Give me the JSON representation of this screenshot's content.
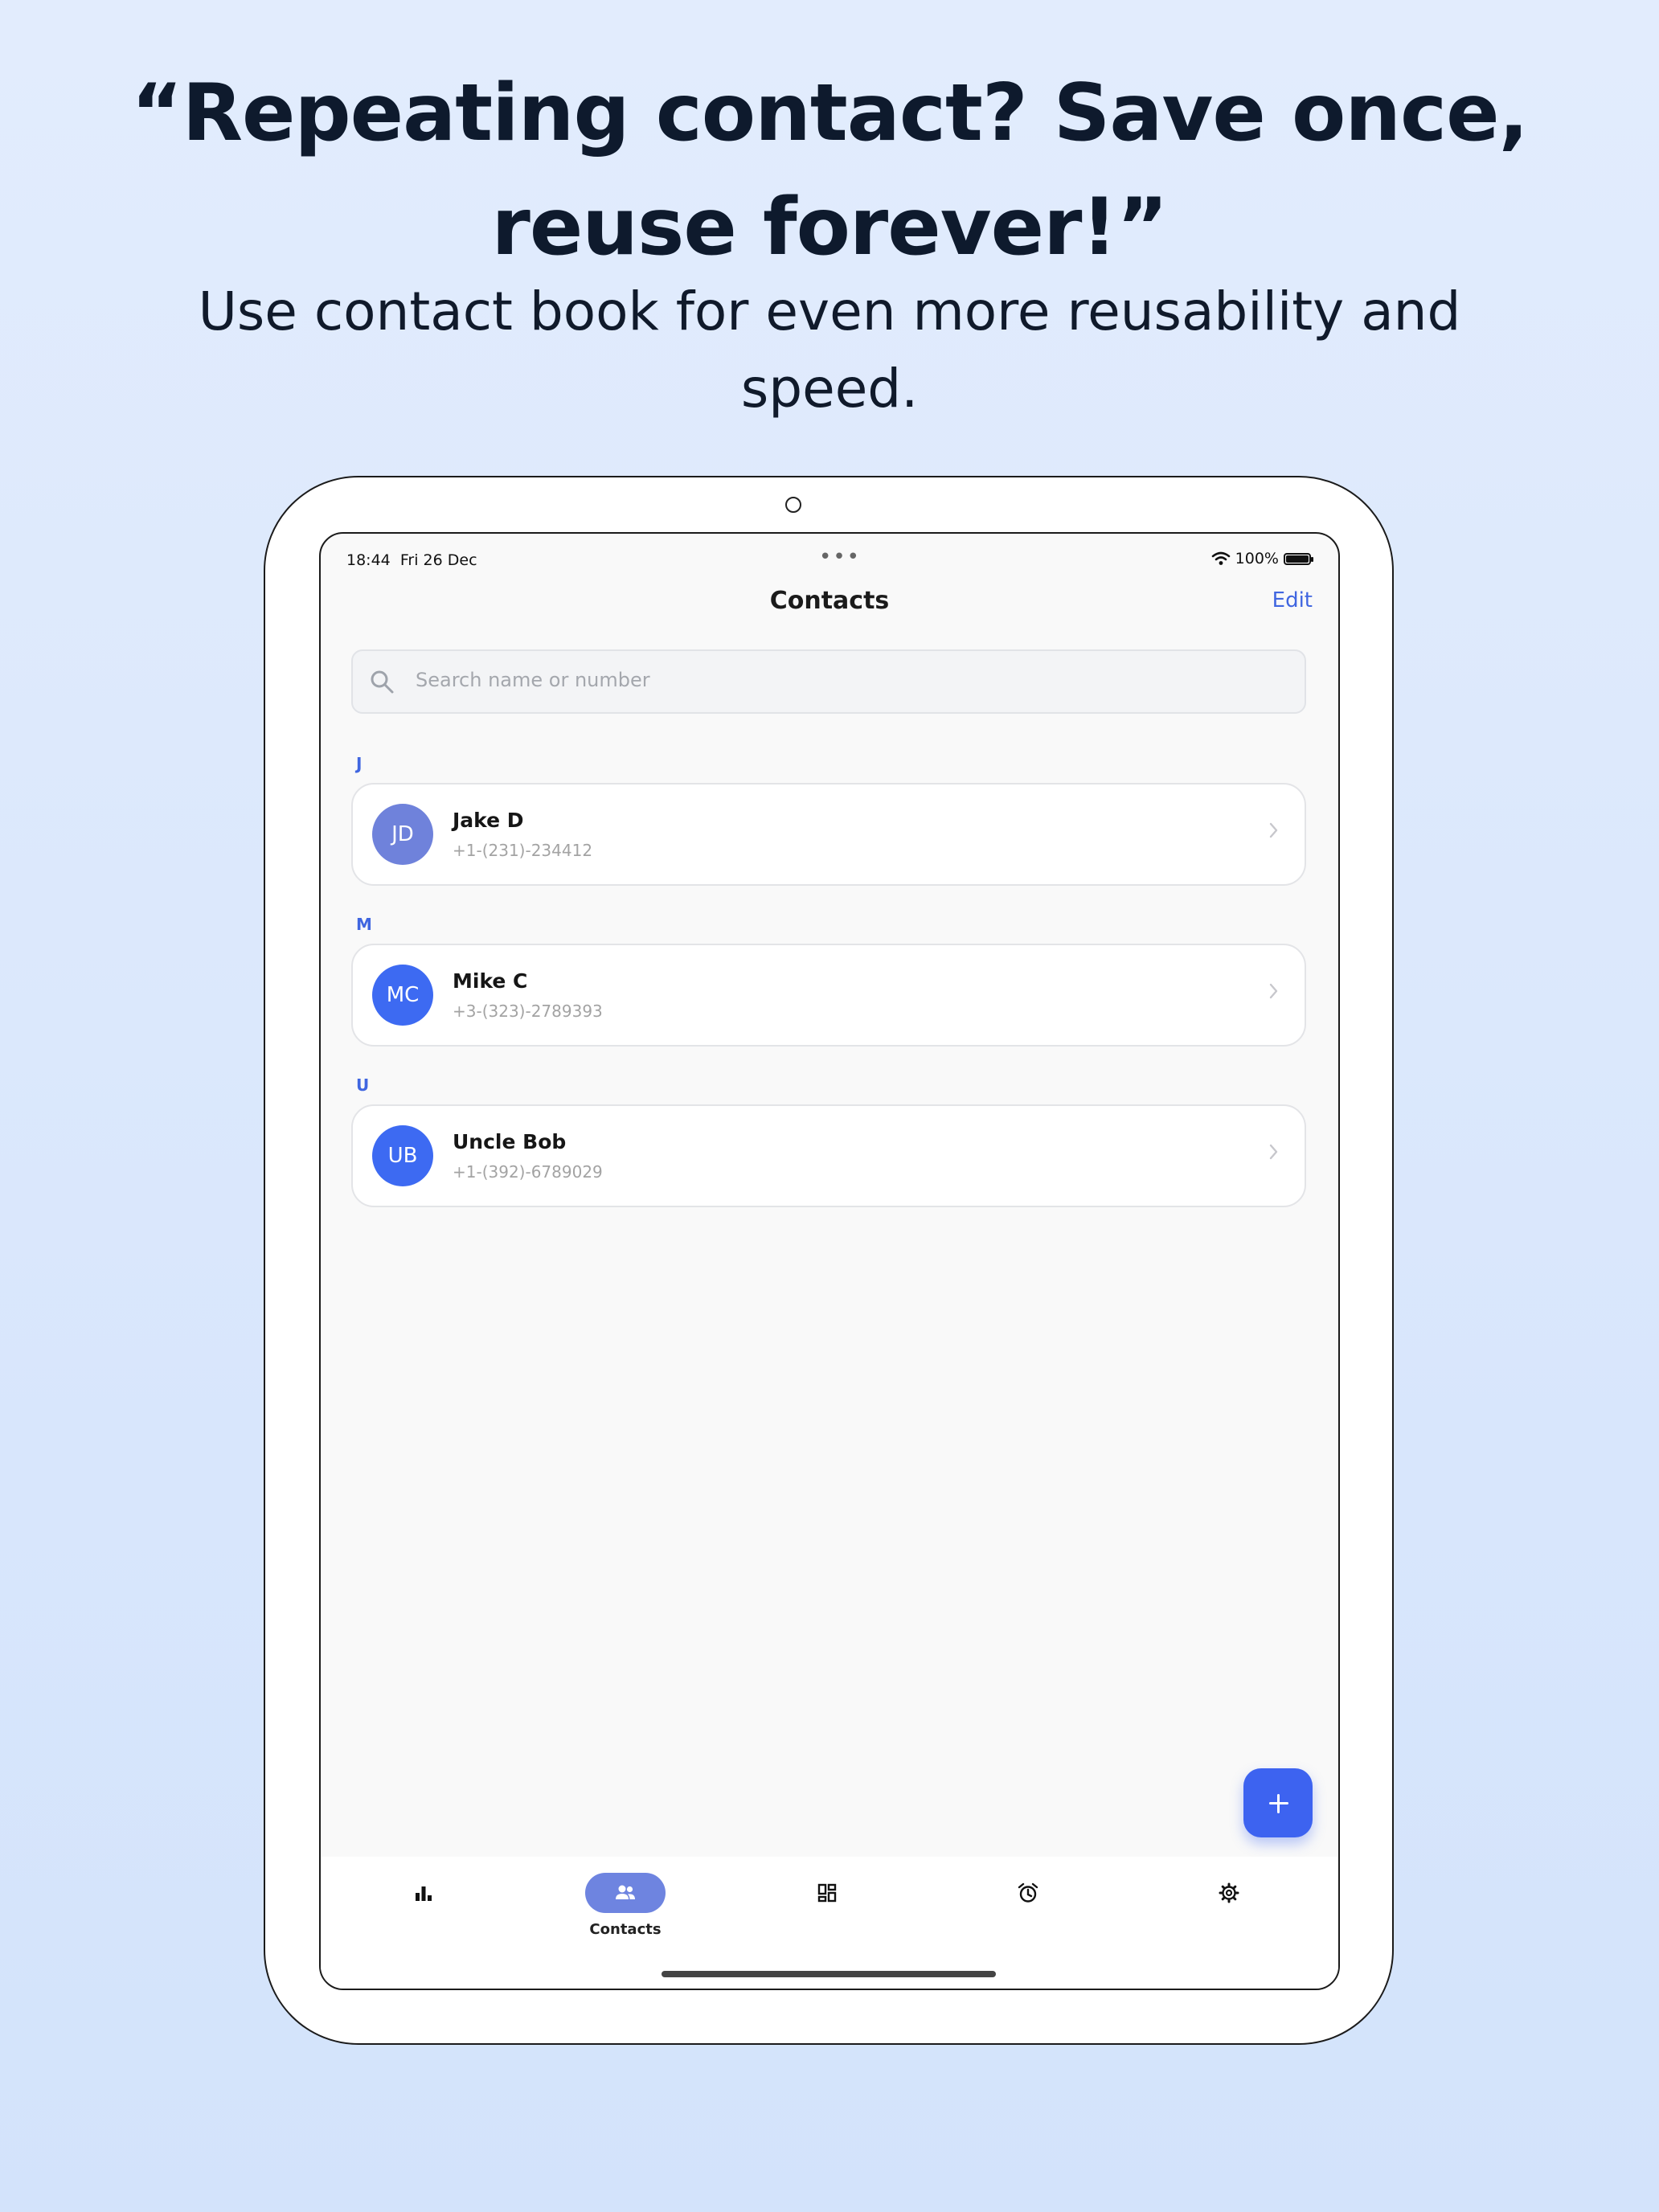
{
  "marketing": {
    "headline_line1": "“Repeating contact? Save once,",
    "headline_line2": "reuse forever!”",
    "subline_line1": "Use contact book for even more reusability and",
    "subline_line2": "speed."
  },
  "status_bar": {
    "time": "18:44",
    "date": "Fri 26 Dec",
    "battery": "100%"
  },
  "header": {
    "title": "Contacts",
    "edit_label": "Edit"
  },
  "search": {
    "placeholder": "Search name or number"
  },
  "sections": [
    {
      "letter": "J",
      "contacts": [
        {
          "initials": "JD",
          "name": "Jake D",
          "phone": "+1-(231)-234412",
          "avatar_color": "#6f82db"
        }
      ]
    },
    {
      "letter": "M",
      "contacts": [
        {
          "initials": "MC",
          "name": "Mike C",
          "phone": "+3-(323)-2789393",
          "avatar_color": "#3d6af2"
        }
      ]
    },
    {
      "letter": "U",
      "contacts": [
        {
          "initials": "UB",
          "name": "Uncle Bob",
          "phone": "+1-(392)-6789029",
          "avatar_color": "#3d6af2"
        }
      ]
    }
  ],
  "tabbar": {
    "items": [
      {
        "icon": "bar-chart-icon",
        "label": ""
      },
      {
        "icon": "people-icon",
        "label": "Contacts",
        "active": true
      },
      {
        "icon": "grid-icon",
        "label": ""
      },
      {
        "icon": "alarm-icon",
        "label": ""
      },
      {
        "icon": "gear-icon",
        "label": ""
      }
    ]
  },
  "colors": {
    "accent": "#4066e0",
    "fab": "#3d63f0",
    "active_tab_pill": "#6e84e0"
  }
}
